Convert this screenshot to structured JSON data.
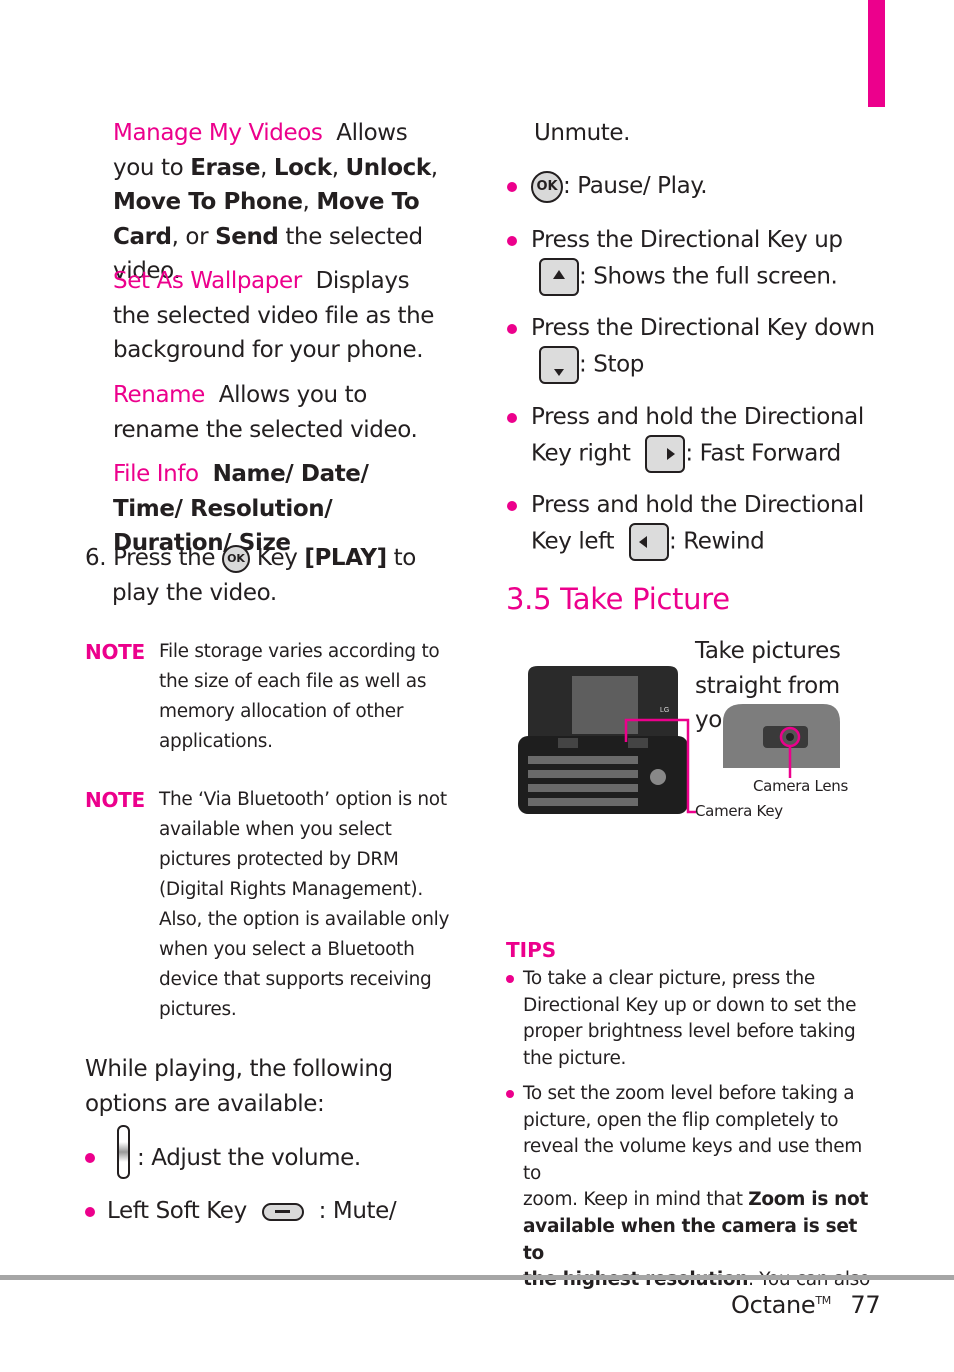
{
  "accent_color": "#ec008c",
  "left_column": {
    "manage_videos": {
      "term": "Manage My Videos",
      "parts": [
        "Allows you to ",
        "Erase",
        ", ",
        "Lock",
        ", ",
        "Unlock",
        ", ",
        "Move To Phone",
        ", ",
        "Move To Card",
        ", or ",
        "Send",
        " the selected video."
      ]
    },
    "set_wallpaper": {
      "term": "Set As Wallpaper",
      "desc": "Displays the selected video file as the background for your phone."
    },
    "rename": {
      "term": "Rename",
      "desc": "Allows you to rename the selected video."
    },
    "file_info": {
      "term": "File Info",
      "desc": "Name/ Date/ Time/ Resolution/ Duration/ Size"
    },
    "step6": {
      "number": "6.",
      "before": "Press the",
      "ok_label": "OK",
      "key_label": "Key",
      "play_label": "[PLAY]",
      "after_line1": "to",
      "line2": "play the video."
    },
    "notes": [
      {
        "label": "NOTE",
        "lines": [
          "File storage varies according to",
          "the size of each file as well as",
          "memory allocation of other",
          "applications."
        ]
      },
      {
        "label": "NOTE",
        "lines": [
          "The ‘Via Bluetooth’ option is not",
          "available when you select",
          "pictures protected by DRM",
          "(Digital Rights Management).",
          "Also, the option is available only",
          "when you select a Bluetooth",
          "device that supports receiving",
          "pictures."
        ]
      }
    ],
    "while_playing": [
      "While playing, the following",
      "options are available:"
    ],
    "bullets": [
      {
        "text": ": Adjust the volume.",
        "icon": "volume-key-icon"
      },
      {
        "before": "Left Soft Key",
        "text": ": Mute/",
        "icon": "left-soft-key-icon"
      }
    ]
  },
  "right_column": {
    "unmute": "Unmute.",
    "bullets": [
      {
        "ok_label": "OK",
        "text": ": Pause/ Play."
      },
      {
        "line1": "Press the Directional Key up",
        "text": ": Shows the full screen."
      },
      {
        "line1": "Press the Directional Key down",
        "text": ": Stop"
      },
      {
        "line1": "Press and hold the Directional",
        "before": "Key right",
        "text": ": Fast Forward"
      },
      {
        "line1": "Press and hold the Directional",
        "before": "Key left",
        "text": ": Rewind"
      }
    ],
    "section_title": "3.5 Take Picture",
    "intro_lines": [
      "Take pictures",
      "straight from",
      "yo"
    ],
    "callouts": {
      "camera_lens": "Camera Lens",
      "camera_key": "Camera Key"
    },
    "tips": {
      "label": "TIPS",
      "items": [
        {
          "lines": [
            "To take a clear picture, press the",
            "Directional Key up or down to set the",
            "proper brightness level before taking",
            "the picture."
          ]
        },
        {
          "lines": [
            "To set the zoom level before taking a",
            "picture, open the flip completely to",
            "reveal the volume keys and use them to"
          ],
          "line4_normal": "zoom. Keep in mind that ",
          "line4_bold": "Zoom is not",
          "line5_bold": "available when the camera is set to",
          "line6_bold": "the highest resolution",
          "line6_normal": ". You can also"
        }
      ]
    }
  },
  "footer": {
    "product": "Octane",
    "trademark": "TM",
    "page_number": "77"
  }
}
